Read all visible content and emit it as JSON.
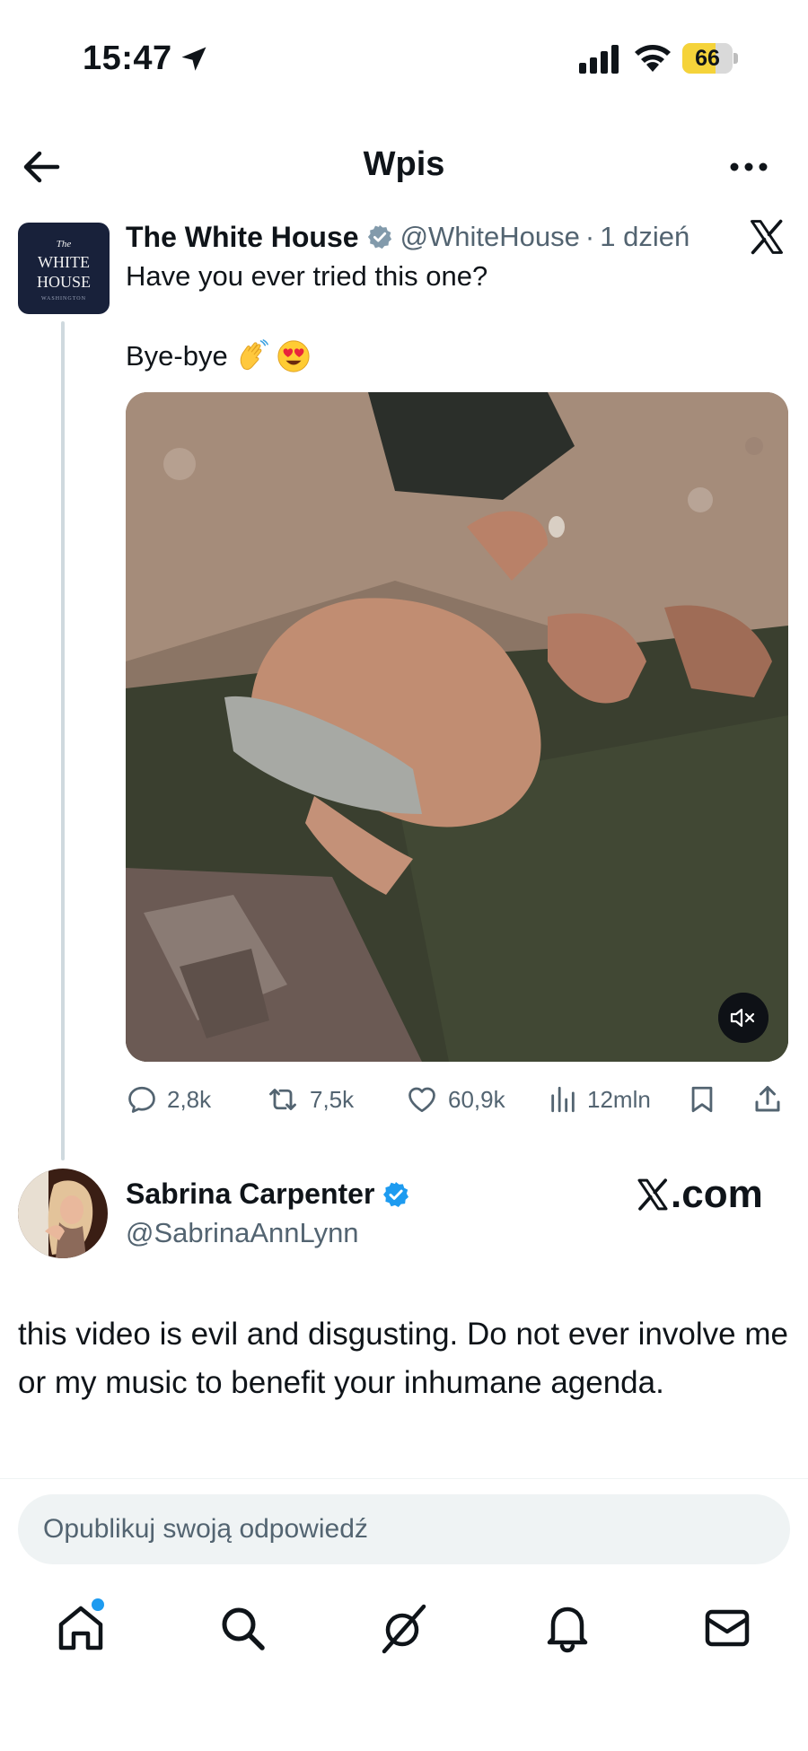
{
  "status_bar": {
    "time": "15:47",
    "battery": "66",
    "battery_level": 0.66
  },
  "header": {
    "title": "Wpis"
  },
  "tweet": {
    "author_name": "The White House",
    "author_handle": "@WhiteHouse",
    "separator": "·",
    "time_ago": "1 dzień",
    "avatar_text": {
      "line0": "The",
      "line1": "WHITE",
      "line2": "HOUSE",
      "line3": "WASHINGTON"
    },
    "text_line1": "Have you ever tried this one?",
    "text_line2": "Bye-bye",
    "emojis": [
      "waving-hand-emoji",
      "heart-eyes-emoji"
    ],
    "media": {
      "type": "video",
      "muted": true
    },
    "stats": {
      "replies": "2,8k",
      "reposts": "7,5k",
      "likes": "60,9k",
      "views": "12mln"
    }
  },
  "reply": {
    "author_name": "Sabrina Carpenter",
    "author_handle": "@SabrinaAnnLynn",
    "source_label": ".com",
    "text": "this video is evil and disgusting. Do not ever involve me or my music to benefit your inhumane agenda."
  },
  "composer": {
    "placeholder": "Opublikuj swoją odpowiedź"
  },
  "bottom_nav": [
    "home-icon",
    "search-icon",
    "grok-icon",
    "notifications-icon",
    "messages-icon"
  ],
  "colors": {
    "accent": "#1d9bf0",
    "text": "#0f1419",
    "muted": "#536471",
    "battery": "#f5d33a"
  }
}
